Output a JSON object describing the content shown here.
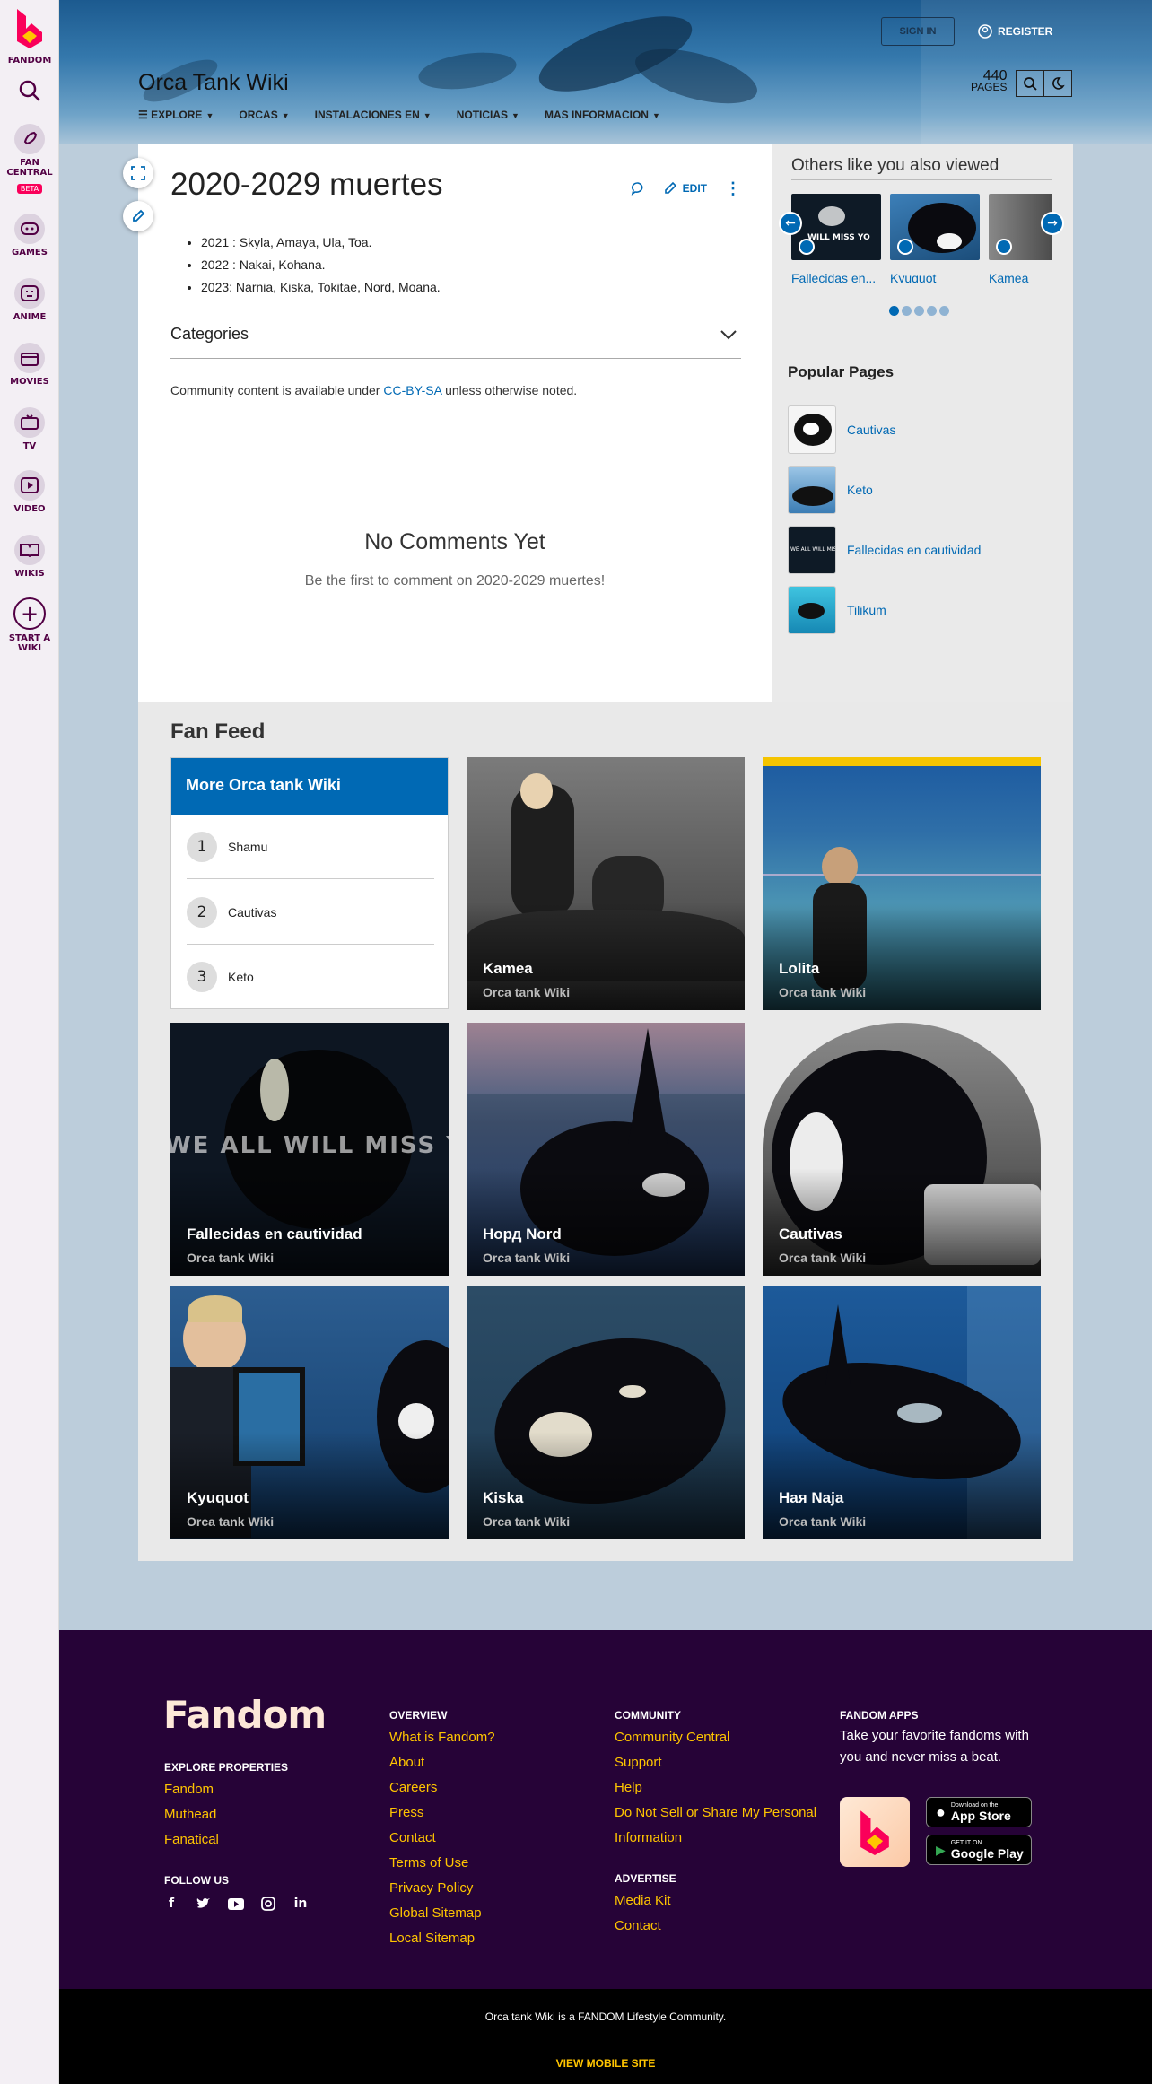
{
  "rail": {
    "items": [
      {
        "label": "FANDOM"
      },
      {
        "label": ""
      },
      {
        "label": "FAN CENTRAL",
        "badge": "BETA"
      },
      {
        "label": "GAMES"
      },
      {
        "label": "ANIME"
      },
      {
        "label": "MOVIES"
      },
      {
        "label": "TV"
      },
      {
        "label": "VIDEO"
      },
      {
        "label": "WIKIS"
      },
      {
        "label": "START A WIKI"
      }
    ]
  },
  "header": {
    "wiki_title": "Orca Tank Wiki",
    "signin": "SIGN IN",
    "register": "REGISTER",
    "pages_count": "440",
    "pages_label": "PAGES",
    "nav": [
      "EXPLORE",
      "ORCAS",
      "INSTALACIONES EN",
      "NOTICIAS",
      "MAS INFORMACION"
    ]
  },
  "article": {
    "title": "2020-2029 muertes",
    "edit": "EDIT",
    "bullets": [
      "2021 : Skyla, Amaya, Ula, Toa.",
      "2022 : Nakai, Kohana.",
      "2023: Narnia, Kiska, Tokitae, Nord, Moana."
    ],
    "categories": "Categories",
    "license_pre": "Community content is available under ",
    "license_link": "CC-BY-SA",
    "license_post": " unless otherwise noted.",
    "no_comments_title": "No Comments Yet",
    "no_comments_text": "Be the first to comment on 2020-2029 muertes!"
  },
  "right_rail": {
    "also_viewed_title": "Others like you also viewed",
    "also_viewed": [
      "Fallecidas en...",
      "Kyuquot",
      "Kamea"
    ],
    "popular_title": "Popular Pages",
    "popular": [
      "Cautivas",
      "Keto",
      "Fallecidas en cautividad",
      "Tilikum"
    ]
  },
  "fan_feed": {
    "title": "Fan Feed",
    "more_title": "More Orca tank Wiki",
    "more_items": [
      {
        "num": "1",
        "label": "Shamu"
      },
      {
        "num": "2",
        "label": "Cautivas"
      },
      {
        "num": "3",
        "label": "Keto"
      }
    ],
    "tiles": [
      {
        "title": "Kamea",
        "sub": "Orca tank Wiki"
      },
      {
        "title": "Lolita",
        "sub": "Orca tank Wiki"
      },
      {
        "title": "Fallecidas en cautividad",
        "sub": "Orca tank Wiki"
      },
      {
        "title": "Норд Nord",
        "sub": "Orca tank Wiki"
      },
      {
        "title": "Cautivas",
        "sub": "Orca tank Wiki"
      },
      {
        "title": "Kyuquot",
        "sub": "Orca tank Wiki"
      },
      {
        "title": "Kiska",
        "sub": "Orca tank Wiki"
      },
      {
        "title": "Ная Naja",
        "sub": "Orca tank Wiki"
      }
    ],
    "watermark": "WE ALL WILL MISS YOU",
    "watermark_small": "WILL MISS YO"
  },
  "footer": {
    "logo": "Fandom",
    "explore_heading": "EXPLORE PROPERTIES",
    "explore": [
      "Fandom",
      "Muthead",
      "Fanatical"
    ],
    "follow_heading": "FOLLOW US",
    "overview_heading": "OVERVIEW",
    "overview": [
      "What is Fandom?",
      "About",
      "Careers",
      "Press",
      "Contact",
      "Terms of Use",
      "Privacy Policy",
      "Global Sitemap",
      "Local Sitemap"
    ],
    "community_heading": "COMMUNITY",
    "community": [
      "Community Central",
      "Support",
      "Help",
      "Do Not Sell or Share My Personal",
      "Information"
    ],
    "advertise_heading": "ADVERTISE",
    "advertise": [
      "Media Kit",
      "Contact"
    ],
    "apps_heading": "FANDOM APPS",
    "apps_text_1": "Take your favorite fandoms with",
    "apps_text_2": "you and never miss a beat.",
    "appstore_small": "Download on the",
    "appstore": "App Store",
    "googleplay_small": "GET IT ON",
    "googleplay": "Google Play",
    "community_line": "Orca tank Wiki is a FANDOM Lifestyle Community.",
    "mobile": "VIEW MOBILE SITE"
  },
  "colors": {
    "accent": "#0069b4",
    "footer_bg": "#260337",
    "link_yellow": "#ffc500",
    "fandom_pink": "#fa005a"
  }
}
